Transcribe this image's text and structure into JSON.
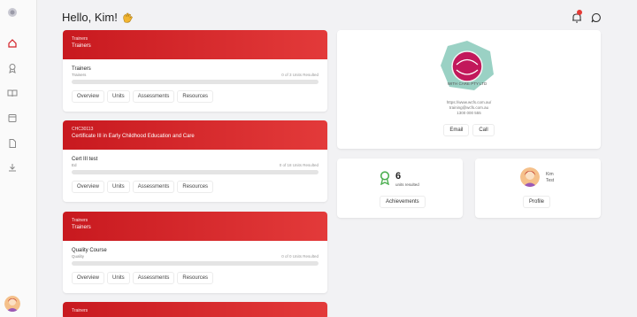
{
  "header": {
    "greeting": "Hello, Kim!"
  },
  "courses": [
    {
      "code": "Trainers",
      "title": "Trainers",
      "name": "Trainers",
      "sub": "Trainers",
      "units": "0 of 3 Units Resulted",
      "buttons": [
        "Overview",
        "Units",
        "Assessments",
        "Resources"
      ]
    },
    {
      "code": "CHC30113",
      "title": "Certificate III in Early Childhood Education and Care",
      "name": "Cert III test",
      "sub": "Ed",
      "units": "0 of 18 Units Resulted",
      "buttons": [
        "Overview",
        "Units",
        "Assessments",
        "Resources"
      ]
    },
    {
      "code": "Trainers",
      "title": "Trainers",
      "name": "Quality Course",
      "sub": "Quality",
      "units": "0 of 0 Units Resulted",
      "buttons": [
        "Overview",
        "Units",
        "Assessments",
        "Resources"
      ]
    },
    {
      "code": "Trainers"
    }
  ],
  "org": {
    "logo_text": "WITH CARE PTY LTD",
    "website": "https://www.wcfs.com.au/",
    "email": "training@wcfs.com.au",
    "phone": "1300 000 555",
    "email_label": "Email",
    "call_label": "Call"
  },
  "achievements": {
    "count": "6",
    "caption": "units resulted",
    "button": "Achievements"
  },
  "profile": {
    "first": "Kim",
    "last": "Test",
    "button": "Profile"
  },
  "colors": {
    "accent": "#d32027",
    "success": "#4caf50"
  }
}
